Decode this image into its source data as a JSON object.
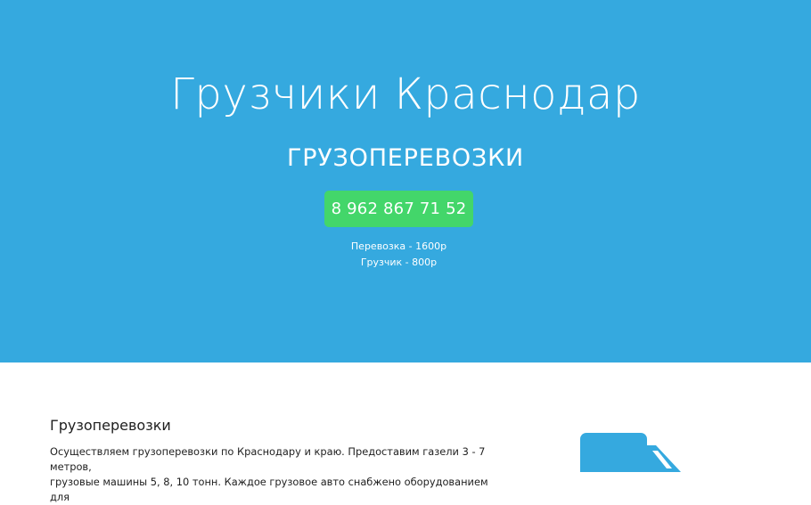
{
  "hero": {
    "title": "Грузчики Краснодар",
    "subtitle": "ГРУЗОПЕРЕВОЗКИ",
    "phone_button": "8 962 867 71 52",
    "prices": [
      "Перевозка - 1600р",
      "Грузчик - 800р"
    ]
  },
  "content": {
    "heading": "Грузоперевозки",
    "text_line_1": "Осуществляем грузоперевозки по Краснодару и краю. Предоставим газели 3 - 7 метров,",
    "text_line_2": "грузовые машины 5, 8, 10 тонн. Каждое грузовое авто снабжено оборудованием для"
  },
  "icons": {
    "truck": "truck-icon"
  },
  "colors": {
    "hero_background": "#35a9df",
    "button_background": "#43d66a",
    "icon_color": "#35a9df"
  }
}
